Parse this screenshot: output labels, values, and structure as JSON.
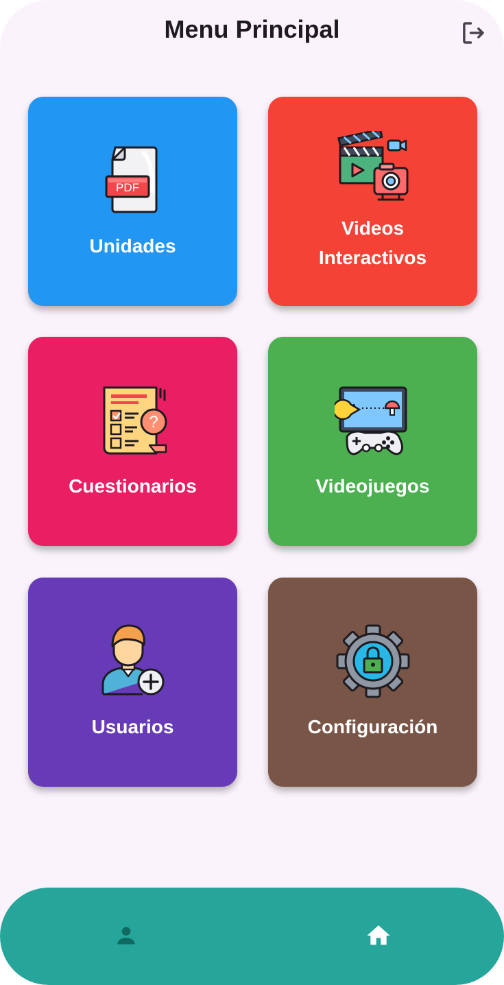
{
  "header": {
    "title": "Menu Principal",
    "logout_icon": "logout-icon"
  },
  "menu": {
    "items": [
      {
        "label": "Unidades",
        "icon": "pdf-document-icon",
        "color": "#2196f3"
      },
      {
        "label": "Videos\nInteractivos",
        "icon": "video-clapper-camera-icon",
        "color": "#f44336"
      },
      {
        "label": "Cuestionarios",
        "icon": "questionnaire-icon",
        "color": "#e91e63"
      },
      {
        "label": "Videojuegos",
        "icon": "game-controller-icon",
        "color": "#4caf50"
      },
      {
        "label": "Usuarios",
        "icon": "add-user-icon",
        "color": "#673ab7"
      },
      {
        "label": "Configuración",
        "icon": "gear-lock-icon",
        "color": "#795548"
      }
    ]
  },
  "pdf_badge": "PDF",
  "bottom_nav": {
    "background": "#26a69a",
    "items": [
      {
        "icon": "person-icon",
        "selected": false
      },
      {
        "icon": "home-icon",
        "selected": true
      }
    ]
  }
}
